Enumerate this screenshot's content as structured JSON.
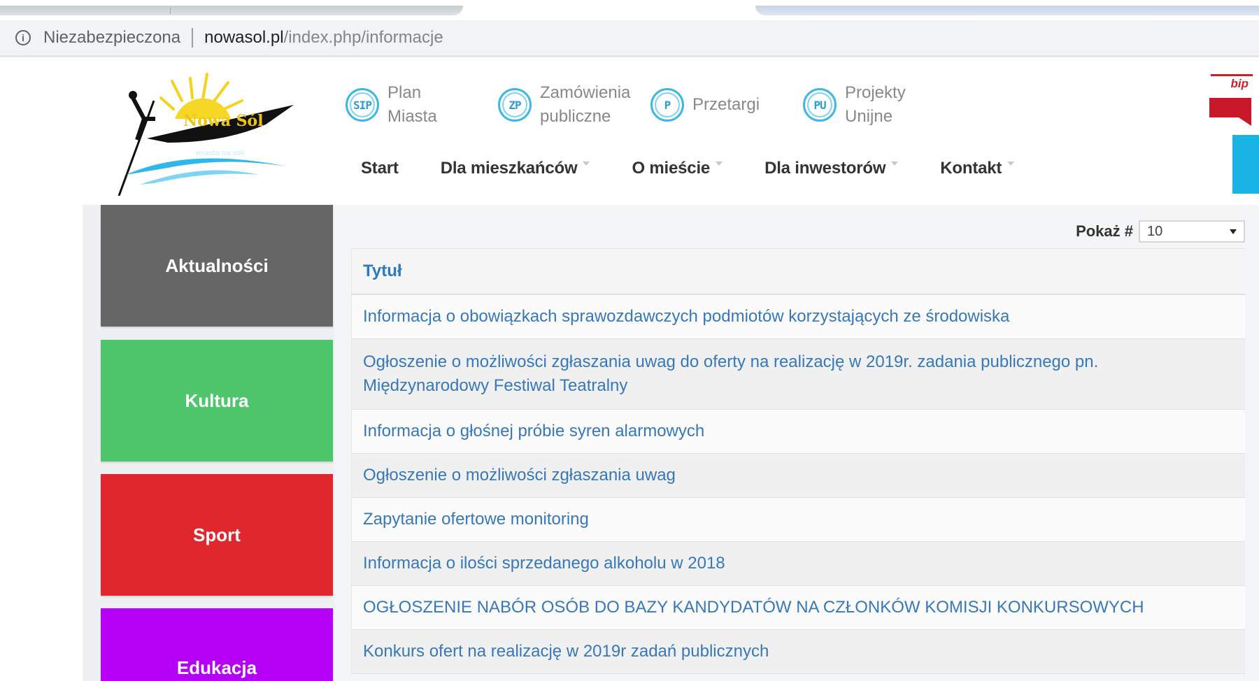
{
  "browser": {
    "insecure_label": "Niezabezpieczona",
    "url_host": "nowasol.pl",
    "url_path": "/index.php/informacje"
  },
  "header": {
    "logo_text": "Nowa Sól",
    "logo_subtext": "miasto na soli",
    "quick_links": [
      {
        "icon": "SIP",
        "label": "Plan Miasta"
      },
      {
        "icon": "ZP",
        "label": "Zamówienia publiczne"
      },
      {
        "icon": "P",
        "label": "Przetargi"
      },
      {
        "icon": "PU",
        "label": "Projekty Unijne"
      }
    ],
    "bip_label": "bip"
  },
  "nav": {
    "items": [
      "Start",
      "Dla mieszkańców",
      "O mieście",
      "Dla inwestorów",
      "Kontakt"
    ]
  },
  "sidebar": {
    "tiles": [
      {
        "label": "Aktualności",
        "color": "#666666"
      },
      {
        "label": "Kultura",
        "color": "#4ec66c"
      },
      {
        "label": "Sport",
        "color": "#e0272e"
      },
      {
        "label": "Edukacja",
        "color": "#b400f5"
      }
    ]
  },
  "list": {
    "show_label": "Pokaż #",
    "show_value": "10",
    "column_title": "Tytuł",
    "rows": [
      "Informacja o obowiązkach sprawozdawczych podmiotów korzystających ze środowiska",
      "Ogłoszenie o możliwości zgłaszania uwag do oferty na realizację w 2019r. zadania publicznego pn. Międzynarodowy Festiwal Teatralny",
      "Informacja o głośnej próbie syren alarmowych",
      "Ogłoszenie o możliwości zgłaszania uwag",
      "Zapytanie ofertowe monitoring",
      "Informacja o ilości sprzedanego alkoholu w 2018",
      "OGŁOSZENIE NABÓR OSÓB DO BAZY KANDYDATÓW NA CZŁONKÓW KOMISJI KONKURSOWYCH",
      "Konkurs ofert na realizację w 2019r zadań publicznych"
    ]
  },
  "colors": {
    "link": "#3778ba",
    "accent_cyan": "#19b3e6",
    "bip_red": "#c8182a"
  }
}
